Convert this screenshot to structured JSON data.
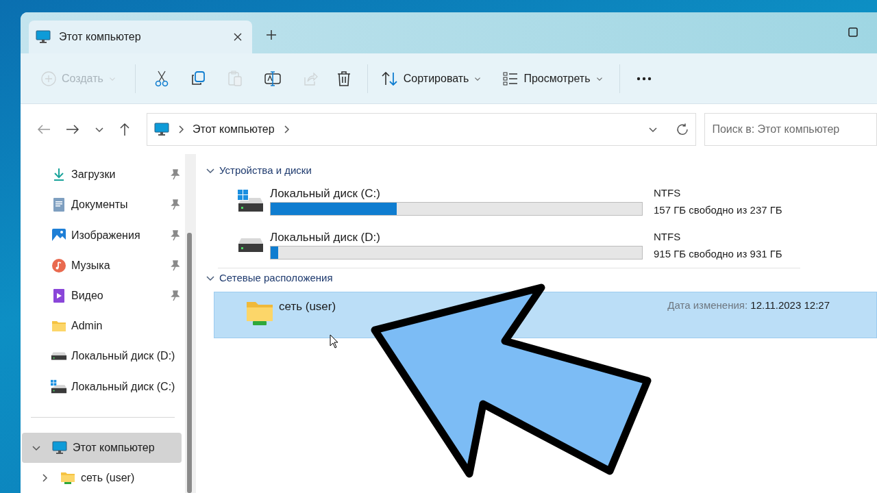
{
  "window": {
    "tabs": [
      {
        "title": "Этот компьютер",
        "selected": true
      }
    ]
  },
  "toolbar": [
    {
      "kind": "create",
      "label": "Создать",
      "disabled": true
    },
    {
      "kind": "cut",
      "disabled": false
    },
    {
      "kind": "copy",
      "disabled": false
    },
    {
      "kind": "paste",
      "disabled": true
    },
    {
      "kind": "rename",
      "disabled": false
    },
    {
      "kind": "share",
      "disabled": true
    },
    {
      "kind": "delete",
      "disabled": false
    },
    {
      "kind": "sort",
      "label": "Сортировать",
      "disabled": false
    },
    {
      "kind": "view",
      "label": "Просмотреть",
      "disabled": false
    },
    {
      "kind": "more",
      "disabled": false
    }
  ],
  "address": {
    "path": [
      "Этот компьютер"
    ],
    "search_placeholder": "Поиск в: Этот компьютер"
  },
  "sidebar": {
    "items": [
      {
        "label": "Загрузки",
        "kind": "download",
        "pinned": true
      },
      {
        "label": "Документы",
        "kind": "document",
        "pinned": true
      },
      {
        "label": "Изображения",
        "kind": "image",
        "pinned": true
      },
      {
        "label": "Музыка",
        "kind": "music",
        "pinned": true
      },
      {
        "label": "Видео",
        "kind": "video",
        "pinned": true
      },
      {
        "label": "Admin",
        "kind": "folder",
        "pinned": false
      },
      {
        "label": "Локальный диск (D:)",
        "kind": "drive",
        "pinned": false
      },
      {
        "label": "Локальный диск (C:)",
        "kind": "system-drive",
        "pinned": false
      }
    ],
    "tree": [
      {
        "label": "Этот компьютер",
        "kind": "computer",
        "expanded": true,
        "selected": true,
        "children": [
          {
            "label": "сеть (user)",
            "kind": "network-folder",
            "expanded": false,
            "selected": false
          }
        ]
      }
    ]
  },
  "groups": [
    {
      "title": "Устройства и диски",
      "expanded": true,
      "items": [
        {
          "kind": "system-drive",
          "name": "Локальный диск (C:)",
          "level": 0.34,
          "filesystem": "NTFS",
          "free": "157 ГБ свободно из 237 ГБ",
          "selected": false
        },
        {
          "kind": "drive",
          "name": "Локальный диск (D:)",
          "level": 0.02,
          "filesystem": "NTFS",
          "free": "915 ГБ свободно из 931 ГБ",
          "selected": false
        }
      ]
    },
    {
      "title": "Сетевые расположения",
      "expanded": true,
      "items": [
        {
          "kind": "network-folder",
          "name": "сеть (user)",
          "date_label": "Дата изменения:",
          "date": "12.11.2023 12:27",
          "selected": true
        }
      ]
    }
  ]
}
